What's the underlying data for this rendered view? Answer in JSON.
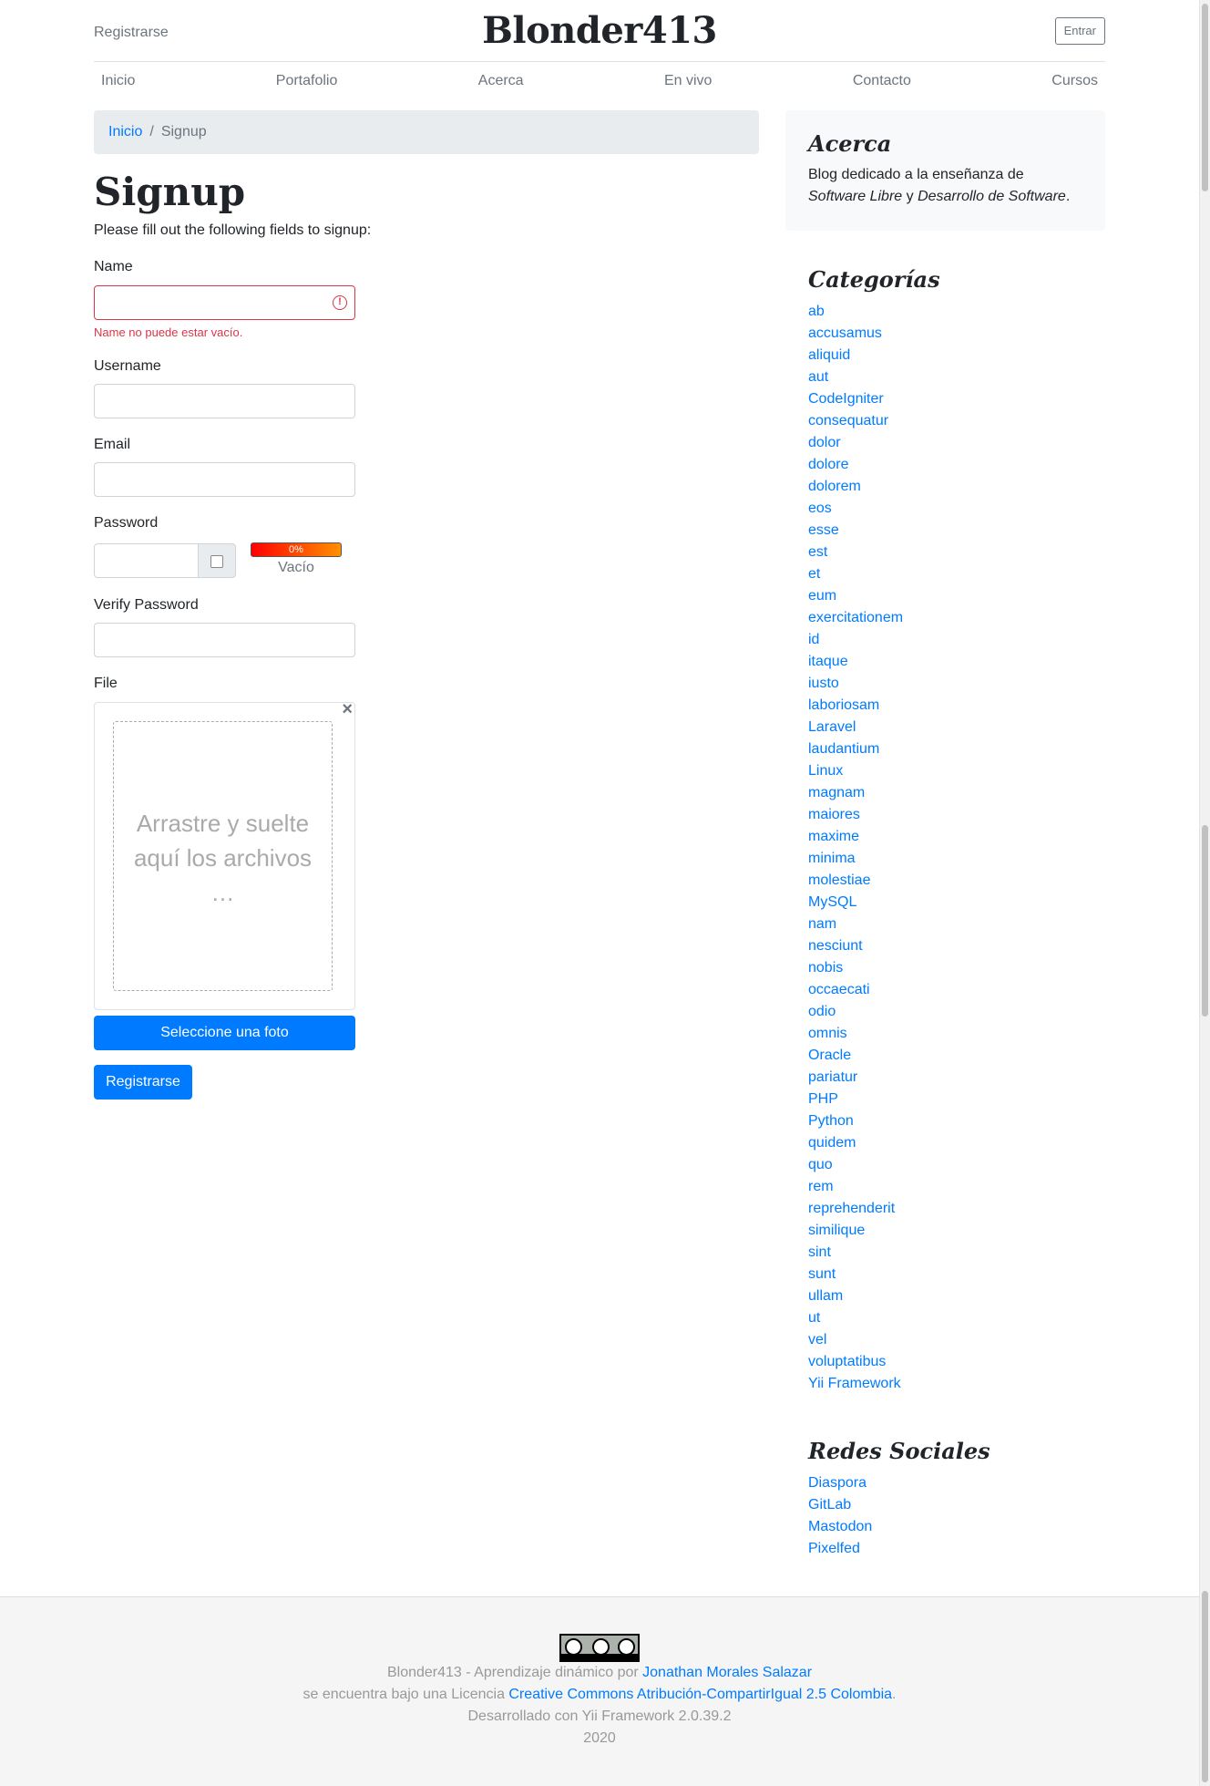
{
  "header": {
    "register_label": "Registrarse",
    "brand": "Blonder413",
    "login_label": "Entrar"
  },
  "nav": {
    "items": [
      "Inicio",
      "Portafolio",
      "Acerca",
      "En vivo",
      "Contacto",
      "Cursos"
    ]
  },
  "breadcrumb": {
    "home": "Inicio",
    "separator": "/",
    "current": "Signup"
  },
  "form": {
    "title": "Signup",
    "intro": "Please fill out the following fields to signup:",
    "name_label": "Name",
    "name_error": "Name no puede estar vacío.",
    "username_label": "Username",
    "email_label": "Email",
    "password_label": "Password",
    "strength_percent": "0%",
    "strength_text": "Vacío",
    "verify_label": "Verify Password",
    "file_label": "File",
    "file_close": "×",
    "drop_text_1": "Arrastre y suelte",
    "drop_text_2": "aquí los archivos",
    "drop_text_3": "…",
    "select_photo_label": "Seleccione una foto",
    "submit_label": "Registrarse"
  },
  "sidebar": {
    "about_title": "Acerca",
    "about_text_1": "Blog dedicado a la enseñanza de",
    "about_em_1": "Software Libre",
    "about_and": " y ",
    "about_em_2": "Desarrollo de Software",
    "about_end": ".",
    "categories_title": "Categorías",
    "categories": [
      "ab",
      "accusamus",
      "aliquid",
      "aut",
      "CodeIgniter",
      "consequatur",
      "dolor",
      "dolore",
      "dolorem",
      "eos",
      "esse",
      "est",
      "et",
      "eum",
      "exercitationem",
      "id",
      "itaque",
      "iusto",
      "laboriosam",
      "Laravel",
      "laudantium",
      "Linux",
      "magnam",
      "maiores",
      "maxime",
      "minima",
      "molestiae",
      "MySQL",
      "nam",
      "nesciunt",
      "nobis",
      "occaecati",
      "odio",
      "omnis",
      "Oracle",
      "pariatur",
      "PHP",
      "Python",
      "quidem",
      "quo",
      "rem",
      "reprehenderit",
      "similique",
      "sint",
      "sunt",
      "ullam",
      "ut",
      "vel",
      "voluptatibus",
      "Yii Framework"
    ],
    "social_title": "Redes Sociales",
    "social": [
      "Diaspora",
      "GitLab",
      "Mastodon",
      "Pixelfed"
    ]
  },
  "footer": {
    "line1_text": "Blonder413 - Aprendizaje dinámico por ",
    "line1_link": "Jonathan Morales Salazar",
    "line2_text": "se encuentra bajo una Licencia ",
    "line2_link": "Creative Commons Atribución-CompartirIgual 2.5 Colombia",
    "line2_end": ".",
    "line3": "Desarrollado con Yii Framework 2.0.39.2",
    "line4": "2020",
    "badge_by": "BY",
    "badge_sa": "SA"
  },
  "colors": {
    "primary": "#007bff",
    "danger": "#dc3545",
    "muted": "#6c757d"
  }
}
